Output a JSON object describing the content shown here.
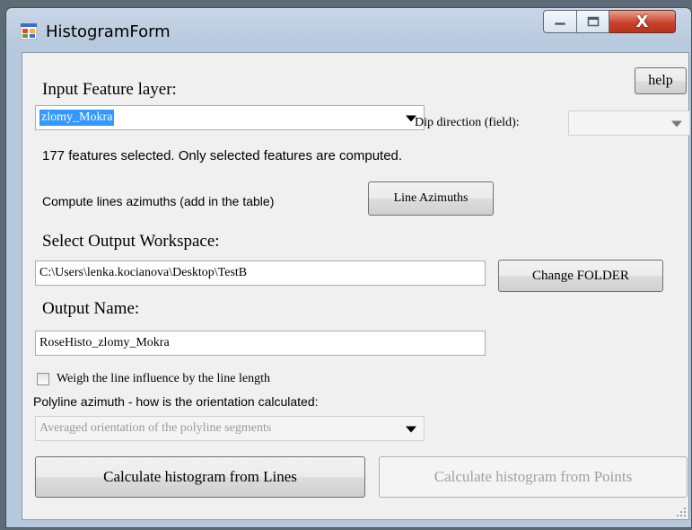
{
  "window": {
    "title": "HistogramForm"
  },
  "captions": {
    "close_glyph": "X"
  },
  "form": {
    "help_label": "help",
    "input_layer_label": "Input Feature layer:",
    "input_layer_value": "zlomy_Mokra",
    "dip_direction_label": "Dip direction (field):",
    "dip_direction_value": "",
    "selection_info": "177 features selected. Only selected features are computed.",
    "azimuth_info": "Compute lines azimuths (add in the table)",
    "line_azimuths_label": "Line Azimuths",
    "output_workspace_label": "Select Output Workspace:",
    "output_workspace_value": "C:\\Users\\lenka.kocianova\\Desktop\\TestB",
    "change_folder_label": "Change FOLDER",
    "output_name_label": "Output Name:",
    "output_name_value": "RoseHisto_zlomy_Mokra",
    "weigh_label": "Weigh the line influence by the line length",
    "weigh_checked": false,
    "polyline_label": "Polyline azimuth - how is the orientation calculated:",
    "polyline_value": "Averaged orientation of the polyline segments",
    "calc_lines_label": "Calculate histogram from Lines",
    "calc_points_label": "Calculate histogram from Points"
  }
}
